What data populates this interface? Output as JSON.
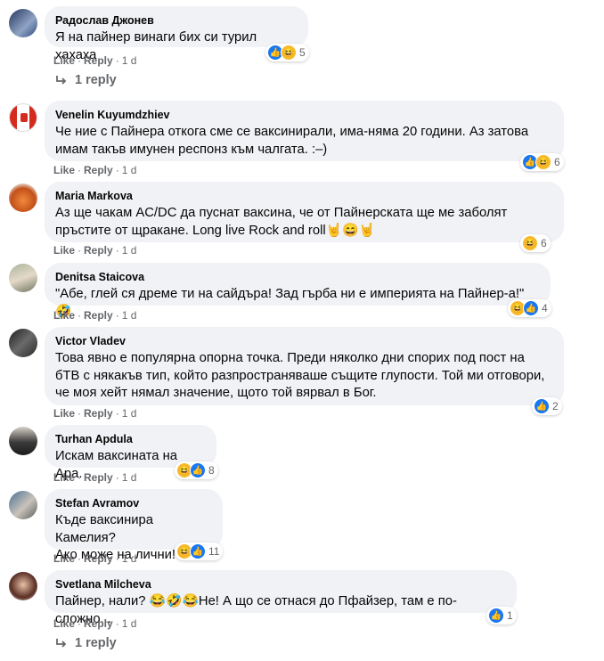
{
  "actions": {
    "like": "Like",
    "reply": "Reply",
    "separator": "·"
  },
  "comments": [
    {
      "name": "Радослав Джонев",
      "lines": [
        "Я на пайнер винаги бих си турил хахаха"
      ],
      "time": "1 d",
      "reactions": [
        "like",
        "haha"
      ],
      "reaction_count": "5",
      "replies": "1 reply"
    },
    {
      "name": "Venelin Kuyumdzhiev",
      "lines": [
        "Че ние с Пайнера откога сме се ваксинирали, има-няма 20 години. Аз затова",
        "имам такъв имунен респонз към чалгата. :–)"
      ],
      "time": "1 d",
      "reactions": [
        "like",
        "haha"
      ],
      "reaction_count": "6"
    },
    {
      "name": "Maria Markova",
      "lines": [
        "Аз ще чакам AC/DC да пуснат ваксина, че от Пайнерската ще ме заболят",
        "пръстите от щракане. Long live Rock and roll🤘😄🤘"
      ],
      "time": "1 d",
      "reactions": [
        "haha"
      ],
      "reaction_count": "6"
    },
    {
      "name": "Denitsa Staicova",
      "lines": [
        "\"Абе, глей ся дреме ти на сайдъра! Зад гърба ни е империята на Пайнер-а!\" 🤣"
      ],
      "time": "1 d",
      "reactions": [
        "haha",
        "like"
      ],
      "reaction_count": "4"
    },
    {
      "name": "Victor Vladev",
      "lines": [
        "Това явно е популярна опорна точка. Преди няколко дни спорих под пост на",
        "бТВ с някакъв тип, който разпространяваше същите глупости. Той ми отговори,",
        "че моя хейт нямал значение, щото той вярвал в Бог."
      ],
      "time": "1 d",
      "reactions": [
        "like"
      ],
      "reaction_count": "2"
    },
    {
      "name": "Turhan Apdula",
      "lines": [
        "Искам ваксината на Ара."
      ],
      "time": "1 d",
      "reactions": [
        "haha",
        "like"
      ],
      "reaction_count": "8"
    },
    {
      "name": "Stefan Avramov",
      "lines": [
        "Къде ваксинира Камелия?",
        "Ако може на лични!"
      ],
      "time": "1 d",
      "reactions": [
        "haha",
        "like"
      ],
      "reaction_count": "11"
    },
    {
      "name": "Svetlana Milcheva",
      "lines": [
        "Пайнер, нали? 😂🤣😂Не! А що се отнася до Пфайзер, там е по-сложно..."
      ],
      "time": "1 d",
      "reactions": [
        "like"
      ],
      "reaction_count": "1",
      "replies": "1 reply"
    }
  ],
  "colors": {
    "bubble": "#f0f2f5",
    "meta": "#65676b",
    "like": "#1877f2",
    "haha": "#f7b928"
  },
  "icons": {
    "like": "thumbs-up-icon",
    "haha": "laughing-face-icon",
    "reply": "reply-arrow-icon"
  }
}
